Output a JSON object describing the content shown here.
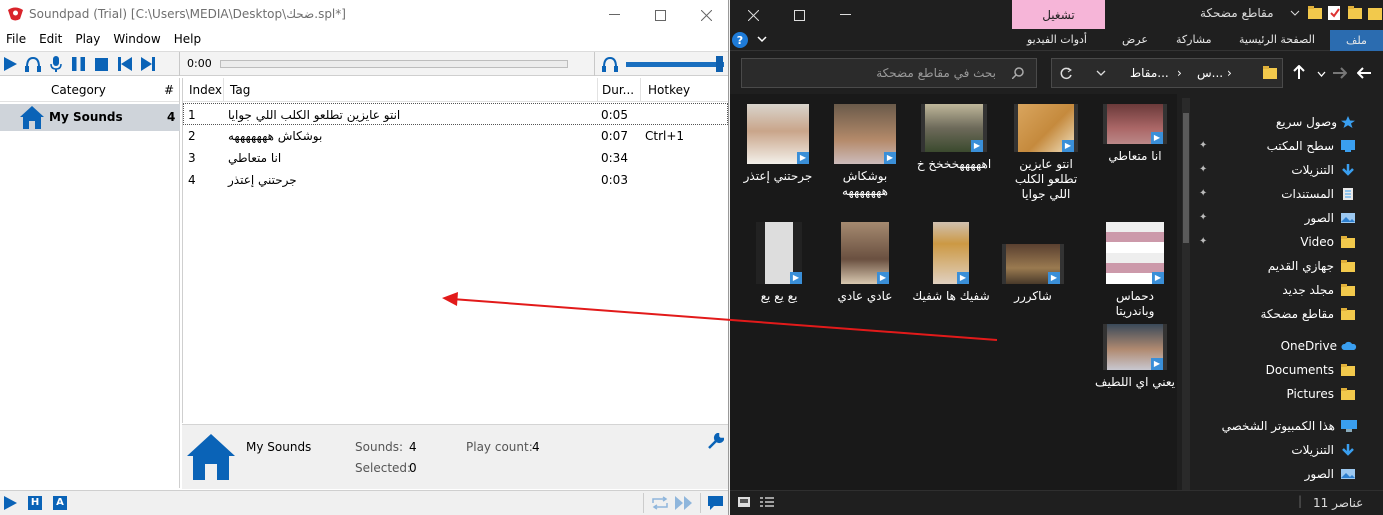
{
  "soundpad": {
    "title": "Soundpad (Trial) [C:\\Users\\MEDIA\\Desktop\\ضحك.spl*]",
    "menu": [
      "File",
      "Edit",
      "Play",
      "Window",
      "Help"
    ],
    "time": "0:00",
    "volume_level": 1.0,
    "category_header": "Category",
    "count_header": "#",
    "category": {
      "name": "My Sounds",
      "count": "4"
    },
    "columns": {
      "index": "Index",
      "tag": "Tag",
      "duration": "Dur...",
      "hotkey": "Hotkey"
    },
    "rows": [
      {
        "index": "1",
        "tag": "انتو عايزين تطلعو الكلب اللي جوايا",
        "duration": "0:05",
        "hotkey": ""
      },
      {
        "index": "2",
        "tag": "بوشكاش هههههههه",
        "duration": "0:07",
        "hotkey": "Ctrl+1"
      },
      {
        "index": "3",
        "tag": "انا متعاطي",
        "duration": "0:34",
        "hotkey": ""
      },
      {
        "index": "4",
        "tag": "جرحتني إعتذر",
        "duration": "0:03",
        "hotkey": ""
      }
    ],
    "info": {
      "name": "My Sounds",
      "sounds_label": "Sounds:",
      "sounds_value": "4",
      "selected_label": "Selected:",
      "selected_value": "0",
      "playcount_label": "Play count:",
      "playcount_value": "4"
    },
    "status_buttons": [
      "H",
      "A"
    ]
  },
  "explorer": {
    "window_name": "مقاطع مضحكة",
    "context_tab": "تشغيل",
    "ribbon_tabs": {
      "file": "ملف",
      "home": "الصفحة الرئيسية",
      "share": "مشاركة",
      "view": "عرض",
      "video_tools": "أدوات الفيديو"
    },
    "address": {
      "part1": "مقاط...",
      "part2": "س..."
    },
    "search_placeholder": "بحث في مقاطع مضحكة",
    "files": [
      {
        "name": "انا متعاطي",
        "icon": "video-file-icon"
      },
      {
        "name": "انتو عايزين تطلعو الكلب اللي جوايا",
        "icon": "video-file-icon"
      },
      {
        "name": "اهههههخخخخ خ",
        "icon": "video-file-icon"
      },
      {
        "name": "بوشكاش هههههههه",
        "icon": "video-file-icon"
      },
      {
        "name": "جرحتني إعتذر",
        "icon": "video-file-icon"
      },
      {
        "name": "دحماس وباندريتا",
        "icon": "video-file-icon"
      },
      {
        "name": "شاكررر",
        "icon": "video-file-icon"
      },
      {
        "name": "شفيك ها شفيك",
        "icon": "video-file-icon"
      },
      {
        "name": "عادي عادي",
        "icon": "video-file-icon"
      },
      {
        "name": "يع يع يع",
        "icon": "video-file-icon"
      },
      {
        "name": "يعني اي اللطيف",
        "icon": "video-file-icon"
      }
    ],
    "nav": [
      {
        "label": "وصول سريع",
        "icon": "star-icon"
      },
      {
        "label": "سطح المكتب",
        "icon": "desktop-icon"
      },
      {
        "label": "التنزيلات",
        "icon": "download-icon"
      },
      {
        "label": "المستندات",
        "icon": "document-icon"
      },
      {
        "label": "الصور",
        "icon": "pictures-icon"
      },
      {
        "label": "Video",
        "icon": "folder-icon"
      },
      {
        "label": "جهازي القديم",
        "icon": "folder-icon"
      },
      {
        "label": "مجلد جديد",
        "icon": "folder-icon"
      },
      {
        "label": "مقاطع مضحكة",
        "icon": "folder-icon"
      },
      {
        "label": "OneDrive",
        "icon": "cloud-icon"
      },
      {
        "label": "Documents",
        "icon": "folder-icon"
      },
      {
        "label": "Pictures",
        "icon": "folder-icon"
      },
      {
        "label": "هذا الكمبيوتر الشخصي",
        "icon": "computer-icon"
      },
      {
        "label": "التنزيلات",
        "icon": "download-icon"
      },
      {
        "label": "الصور",
        "icon": "pictures-icon"
      }
    ],
    "status_text": "11 عناصر"
  },
  "colors": {
    "accent_blue": "#1a6fbf",
    "play_tab_pink": "#f6b5d8",
    "explorer_bg": "#202020",
    "drag_arrow": "#e21a1a"
  }
}
